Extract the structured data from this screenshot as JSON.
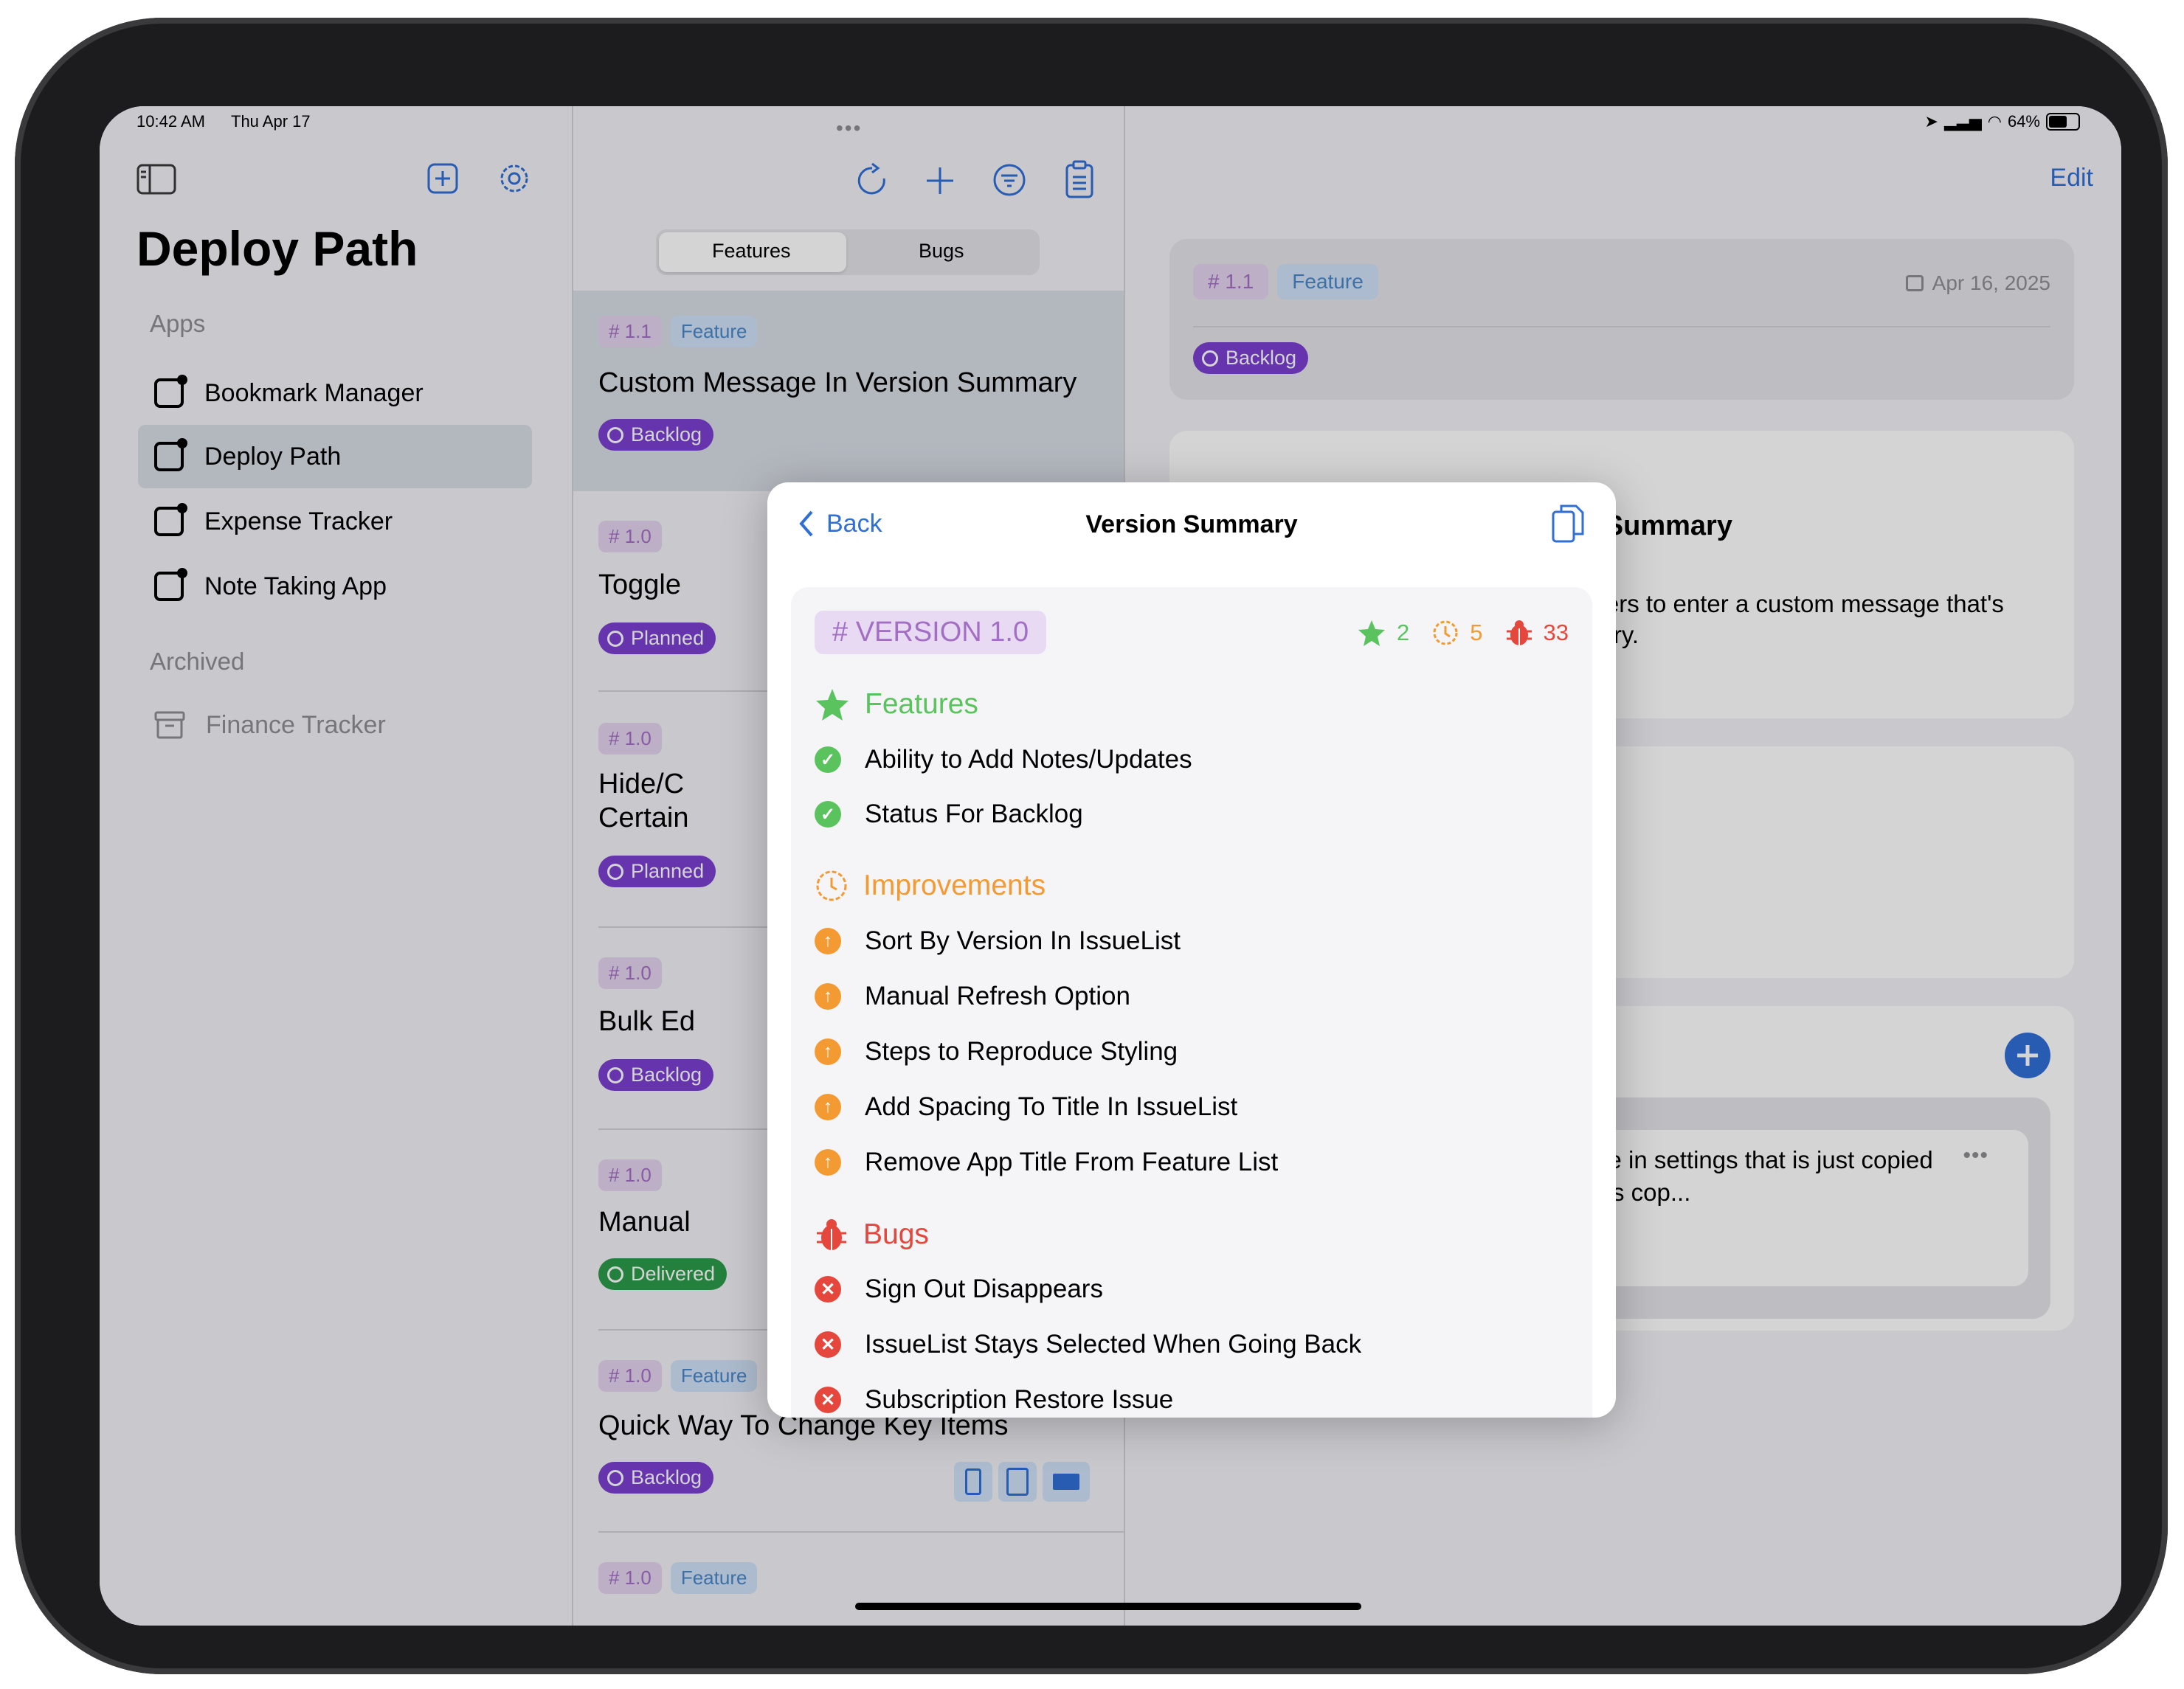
{
  "statusbar": {
    "time": "10:42 AM",
    "date": "Thu Apr 17",
    "battery": "64%"
  },
  "sidebar": {
    "title": "Deploy Path",
    "apps_label": "Apps",
    "apps": [
      {
        "label": "Bookmark Manager"
      },
      {
        "label": "Deploy Path"
      },
      {
        "label": "Expense Tracker"
      },
      {
        "label": "Note Taking App"
      }
    ],
    "archived_label": "Archived",
    "archived": [
      {
        "label": "Finance Tracker"
      }
    ]
  },
  "issue_list": {
    "segments": [
      "Features",
      "Bugs"
    ],
    "cards": [
      {
        "version": "# 1.1",
        "type": "Feature",
        "title": "Custom Message In Version Summary",
        "status": "Backlog"
      },
      {
        "version": "# 1.0",
        "type": "",
        "title": "Toggle",
        "status": "Planned"
      },
      {
        "version": "# 1.0",
        "type": "",
        "title": "Hide/C",
        "title2": "Certain",
        "status": "Planned"
      },
      {
        "version": "# 1.0",
        "type": "",
        "title": "Bulk Ed",
        "status": "Backlog"
      },
      {
        "version": "# 1.0",
        "type": "",
        "title": "Manual",
        "status": "Delivered"
      },
      {
        "version": "# 1.0",
        "type": "Feature",
        "title": "Quick Way To Change Key Items",
        "status": "Backlog"
      },
      {
        "version": "# 1.0",
        "type": "Feature",
        "title": "",
        "status": ""
      }
    ]
  },
  "detail": {
    "edit_label": "Edit",
    "version": "# 1.1",
    "type": "Feature",
    "date": "Apr 16, 2025",
    "status": "Backlog",
    "title_fragment": "n Summary",
    "desc_line1": "users to enter a custom message that's",
    "desc_line2": "mary.",
    "note_line1": "ture in settings that is just copied",
    "note_line2": "ry is cop..."
  },
  "modal": {
    "back_label": "Back",
    "title": "Version Summary",
    "version_label": "# VERSION 1.0",
    "counts": {
      "features": "2",
      "improvements": "5",
      "bugs": "33"
    },
    "features_label": "Features",
    "features": [
      "Ability to Add Notes/Updates",
      "Status For Backlog"
    ],
    "improvements_label": "Improvements",
    "improvements": [
      "Sort By Version In IssueList",
      "Manual Refresh Option",
      "Steps to Reproduce Styling",
      "Add Spacing To Title In IssueList",
      "Remove App Title From Feature List"
    ],
    "bugs_label": "Bugs",
    "bugs": [
      "Sign Out Disappears",
      "IssueList Stays Selected When Going Back",
      "Subscription Restore Issue"
    ]
  },
  "colors": {
    "accent": "#2f6fd6",
    "feature_green": "#5ac35e",
    "improvement_orange": "#f39a33",
    "bug_red": "#e6473d",
    "version_purple": "#a36fc4",
    "status_purple": "#7b3fd0",
    "status_green": "#2c9a4a"
  }
}
